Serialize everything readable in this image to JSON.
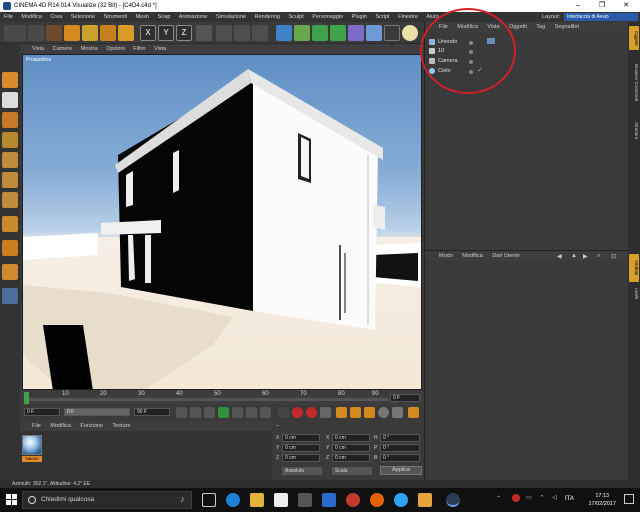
{
  "window": {
    "title": "CINEMA 4D R14.014 Visualize (32 Bit) - [C4D4.c4d *]",
    "buttons": [
      "–",
      "❐",
      "✕"
    ]
  },
  "menubar": {
    "items": [
      "File",
      "Modifica",
      "Crea",
      "Selezione",
      "Strumenti",
      "Mesh",
      "Snap",
      "Animazione",
      "Simulazione",
      "Rendering",
      "Sculpt",
      "Personaggio",
      "Plugin",
      "Script",
      "Finestre",
      "Aiuto"
    ],
    "layout_label": "Layout:",
    "layout_value": "Interfaccia di Avvio"
  },
  "viewport": {
    "menu": [
      "Vista",
      "Camere",
      "Mostra",
      "Opzioni",
      "Filtro",
      "Vista"
    ],
    "label": "Prospettiva"
  },
  "timeline": {
    "ticks": [
      "0",
      "10",
      "20",
      "30",
      "40",
      "50",
      "60",
      "70",
      "80",
      "90"
    ],
    "end_label": "0 F",
    "start_field": "0 F",
    "mid_field": "0 F",
    "range_end": "90 F",
    "max_field": "90 F"
  },
  "materials": {
    "menu": [
      "File",
      "Modifica",
      "Funzione",
      "Texture"
    ],
    "swatch_label": "Nuovo"
  },
  "coordinates": {
    "header": "--",
    "rows": [
      {
        "a": "X",
        "av": "0 cm",
        "b": "X",
        "bv": "0 cm",
        "c": "H",
        "cv": "0 °"
      },
      {
        "a": "Y",
        "av": "0 cm",
        "b": "Y",
        "bv": "0 cm",
        "c": "P",
        "cv": "0 °"
      },
      {
        "a": "Z",
        "av": "0 cm",
        "b": "Z",
        "bv": "0 cm",
        "c": "B",
        "cv": "0 °"
      }
    ],
    "mode1": "Assoluto",
    "mode2": "Scala",
    "apply": "Applica"
  },
  "object_manager": {
    "menu": [
      "File",
      "Modifica",
      "Vista",
      "Oggetti",
      "Tag",
      "Segnalibri"
    ],
    "objects": [
      {
        "name": "Unendo",
        "color": "#8fb3d9"
      },
      {
        "name": "10",
        "color": "#c9c9c9"
      },
      {
        "name": "Camera",
        "color": "#bdbdbd"
      },
      {
        "name": "Cielo",
        "color": "#9cc8ea"
      }
    ]
  },
  "attribute_manager": {
    "menu": [
      "Modo",
      "Modifica",
      "Dati Utente"
    ]
  },
  "right_tabs": [
    "Oggetti",
    "Browser Contenuti",
    "Struttura",
    "Attributi",
    "Livelli"
  ],
  "statusbar": {
    "text": "Azimuth: 302.1°, Altitudine: 4.2°  EE"
  },
  "taskbar": {
    "search_placeholder": "Chiedimi qualcosa",
    "lang": "ITA",
    "time": "17:13",
    "date": "17/02/2017"
  },
  "colors": {
    "accent": "#2b5aa8",
    "annotation": "#d01f26"
  }
}
